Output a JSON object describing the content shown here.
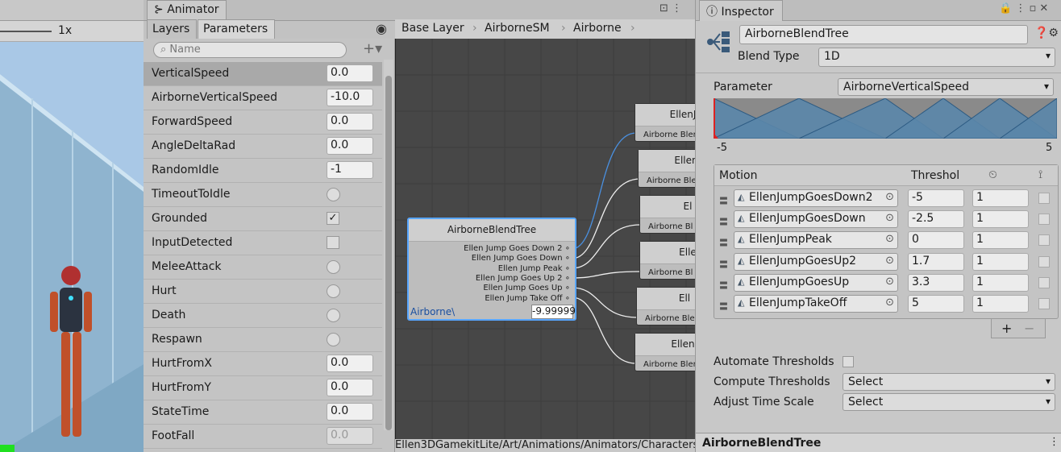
{
  "scene": {
    "zoom": "1x"
  },
  "animator": {
    "title": "Animator",
    "tabs": [
      "Layers",
      "Parameters"
    ],
    "search_placeholder": "Name",
    "breadcrumbs": [
      "Base Layer",
      "AirborneSM",
      "Airborne"
    ],
    "parameters": [
      {
        "name": "VerticalSpeed",
        "type": "float",
        "value": "0.0"
      },
      {
        "name": "AirborneVerticalSpeed",
        "type": "float",
        "value": "-10.0"
      },
      {
        "name": "ForwardSpeed",
        "type": "float",
        "value": "0.0"
      },
      {
        "name": "AngleDeltaRad",
        "type": "float",
        "value": "0.0"
      },
      {
        "name": "RandomIdle",
        "type": "int",
        "value": "-1"
      },
      {
        "name": "TimeoutToIdle",
        "type": "trigger"
      },
      {
        "name": "Grounded",
        "type": "bool",
        "checked": true
      },
      {
        "name": "InputDetected",
        "type": "bool",
        "checked": false
      },
      {
        "name": "MeleeAttack",
        "type": "trigger"
      },
      {
        "name": "Hurt",
        "type": "trigger"
      },
      {
        "name": "Death",
        "type": "trigger"
      },
      {
        "name": "Respawn",
        "type": "trigger"
      },
      {
        "name": "HurtFromX",
        "type": "float",
        "value": "0.0"
      },
      {
        "name": "HurtFromY",
        "type": "float",
        "value": "0.0"
      },
      {
        "name": "StateTime",
        "type": "float",
        "value": "0.0"
      },
      {
        "name": "FootFall",
        "type": "float",
        "value": "0.0"
      }
    ],
    "blend_node": {
      "title": "AirborneBlendTree",
      "outputs": [
        "Ellen Jump Goes Down 2",
        "Ellen Jump Goes Down",
        "Ellen Jump Peak",
        "Ellen Jump Goes Up 2",
        "Ellen Jump Goes Up",
        "Ellen Jump Take Off"
      ],
      "param_label": "Airborne\\",
      "param_value": "-9.99999"
    },
    "clip_nodes": [
      {
        "title": "EllenJ",
        "sub": "Airborne Blen"
      },
      {
        "title": "Ellen",
        "sub": "Airborne Ble"
      },
      {
        "title": "El",
        "sub": "Airborne Bl"
      },
      {
        "title": "Elle",
        "sub": "Airborne Bl"
      },
      {
        "title": "Ell",
        "sub": "Airborne Ble"
      },
      {
        "title": "Ellen",
        "sub": "Airborne Blen"
      }
    ],
    "status_path": "Ellen3DGamekitLite/Art/Animations/Animators/Characters"
  },
  "inspector": {
    "title": "Inspector",
    "object_name": "AirborneBlendTree",
    "blend_type_label": "Blend Type",
    "blend_type": "1D",
    "parameter_label": "Parameter",
    "parameter": "AirborneVerticalSpeed",
    "range_min": "-5",
    "range_max": "5",
    "motion_header": "Motion",
    "threshold_header": "Threshol",
    "motions": [
      {
        "name": "EllenJumpGoesDown2",
        "threshold": "-5",
        "speed": "1"
      },
      {
        "name": "EllenJumpGoesDown",
        "threshold": "-2.5",
        "speed": "1"
      },
      {
        "name": "EllenJumpPeak",
        "threshold": "0",
        "speed": "1"
      },
      {
        "name": "EllenJumpGoesUp2",
        "threshold": "1.7",
        "speed": "1"
      },
      {
        "name": "EllenJumpGoesUp",
        "threshold": "3.3",
        "speed": "1"
      },
      {
        "name": "EllenJumpTakeOff",
        "threshold": "5",
        "speed": "1"
      }
    ],
    "add_label": "+",
    "remove_label": "−",
    "automate_label": "Automate Thresholds",
    "compute_label": "Compute Thresholds",
    "compute_value": "Select",
    "adjust_label": "Adjust Time Scale",
    "adjust_value": "Select",
    "footer_title": "AirborneBlendTree"
  }
}
